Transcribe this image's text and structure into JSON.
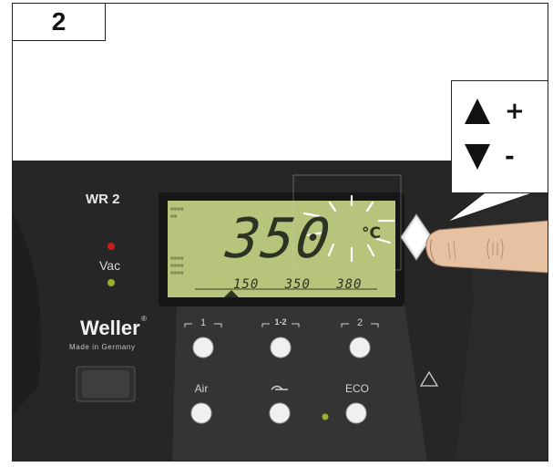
{
  "step": "2",
  "callout": {
    "plus_sign": "+",
    "minus_sign": "-",
    "up_icon": "triangle-up",
    "down_icon": "triangle-down"
  },
  "station": {
    "model": "WR 2",
    "vac_label": "Vac",
    "brand": "Weller",
    "brand_mark": "®",
    "tagline": "Made in Germany"
  },
  "display": {
    "temperature": "350",
    "unit": "°C",
    "presets": [
      "150",
      "350",
      "380"
    ]
  },
  "buttons": {
    "preset1": "1",
    "preset12": "1-2",
    "preset2": "2",
    "air": "Air",
    "eco": "ECO"
  },
  "colors": {
    "panel": "#2b2b2b",
    "lcd": "#b7c47d",
    "led_red": "#c81f1a",
    "led_green": "#9ab02a"
  }
}
